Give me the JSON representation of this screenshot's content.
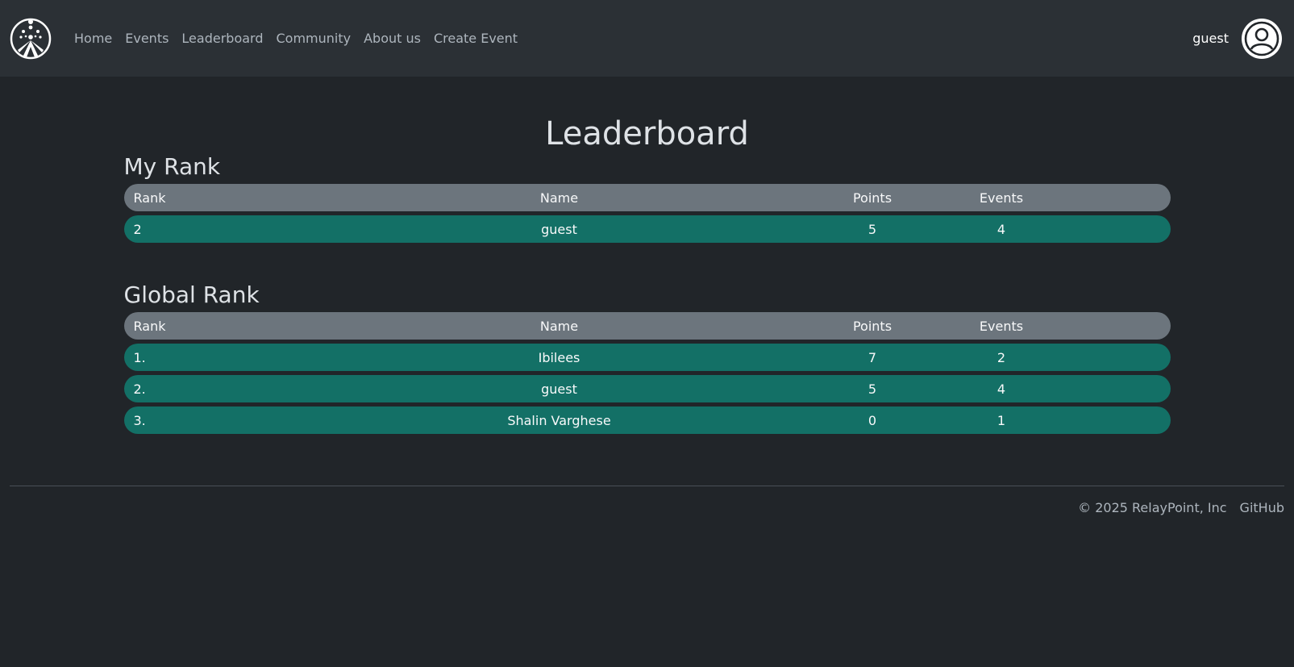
{
  "nav": {
    "links": [
      "Home",
      "Events",
      "Leaderboard",
      "Community",
      "About us",
      "Create Event"
    ],
    "user": "guest"
  },
  "page": {
    "title": "Leaderboard"
  },
  "my_rank": {
    "title": "My Rank",
    "headers": [
      "Rank",
      "Name",
      "Points",
      "Events"
    ],
    "rows": [
      [
        "2",
        "guest",
        "5",
        "4"
      ]
    ]
  },
  "global_rank": {
    "title": "Global Rank",
    "headers": [
      "Rank",
      "Name",
      "Points",
      "Events"
    ],
    "rows": [
      [
        "1.",
        "Ibilees",
        "7",
        "2"
      ],
      [
        "2.",
        "guest",
        "5",
        "4"
      ],
      [
        "3.",
        "Shalin Varghese",
        "0",
        "1"
      ]
    ]
  },
  "footer": {
    "copyright": "© 2025 RelayPoint, Inc",
    "github": "GitHub"
  },
  "colors": {
    "background": "#212529",
    "navbar": "#2b3035",
    "header_row": "#6c757d",
    "data_row": "#137066"
  }
}
